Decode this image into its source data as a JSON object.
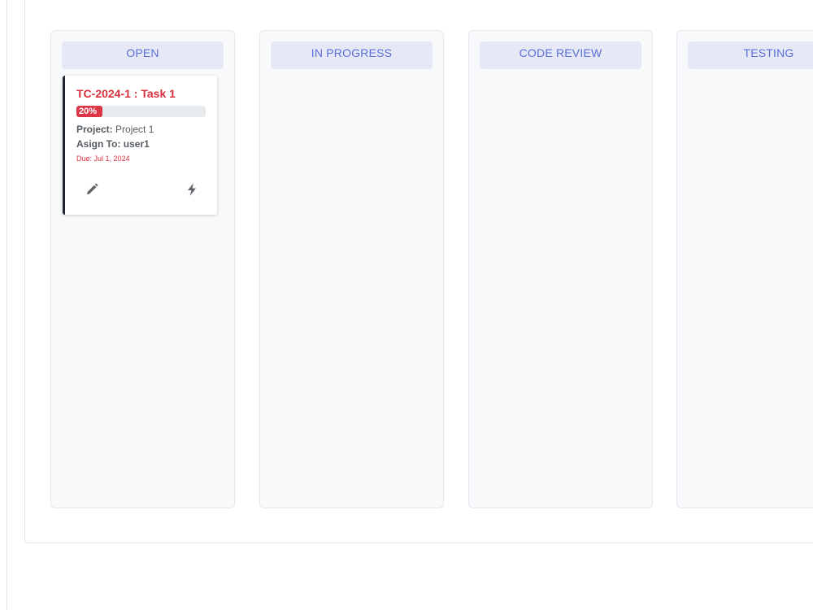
{
  "board": {
    "columns": [
      {
        "label": "OPEN"
      },
      {
        "label": "IN PROGRESS"
      },
      {
        "label": "CODE REVIEW"
      },
      {
        "label": "TESTING"
      }
    ]
  },
  "task": {
    "title": "TC-2024-1 : Task 1",
    "progress": 20,
    "progress_label": "20%",
    "project_label": "Project:",
    "project_value": "Project 1",
    "assign_label": "Asign To:",
    "assign_value": "user1",
    "due": "Due: Jul 1, 2024",
    "actions": [
      {
        "icon": "pencil-icon"
      },
      {
        "icon": "bolt-icon"
      }
    ]
  },
  "colors": {
    "accent": "#5a6fd6",
    "danger": "#dc3545",
    "card_border": "#1f2430"
  }
}
